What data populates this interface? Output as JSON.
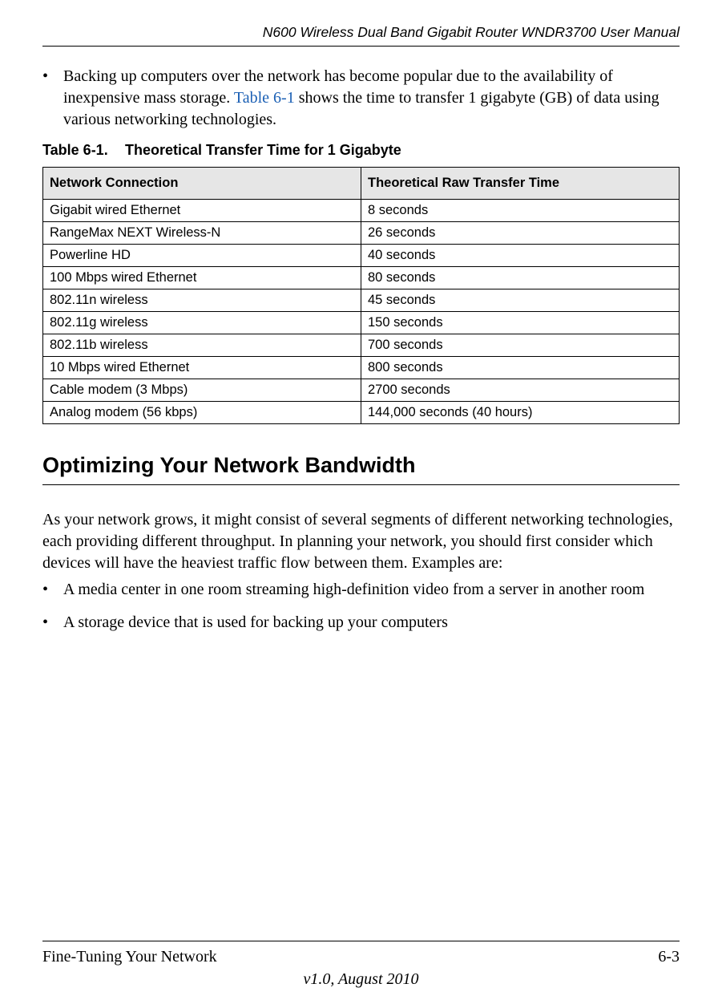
{
  "header": {
    "title": "N600 Wireless Dual Band Gigabit Router WNDR3700 User Manual"
  },
  "intro_bullet": {
    "text_before_link": "Backing up computers over the network has become popular due to the availability of inexpensive mass storage. ",
    "link_text": "Table 6-1",
    "text_after_link": " shows the time to transfer 1 gigabyte (GB) of data using various networking technologies."
  },
  "table": {
    "caption_label": "Table 6-1.",
    "caption_title": "Theoretical Transfer Time for 1 Gigabyte",
    "headers": {
      "col1": "Network Connection",
      "col2": "Theoretical Raw Transfer Time"
    },
    "rows": [
      {
        "connection": "Gigabit wired Ethernet",
        "time": "8 seconds"
      },
      {
        "connection": "RangeMax NEXT Wireless-N",
        "time": "26 seconds"
      },
      {
        "connection": "Powerline HD",
        "time": "40 seconds"
      },
      {
        "connection": "100 Mbps wired Ethernet",
        "time": "80 seconds"
      },
      {
        "connection": "802.11n wireless",
        "time": "45 seconds"
      },
      {
        "connection": "802.11g wireless",
        "time": "150 seconds"
      },
      {
        "connection": "802.11b wireless",
        "time": "700 seconds"
      },
      {
        "connection": "10 Mbps wired Ethernet",
        "time": "800 seconds"
      },
      {
        "connection": "Cable modem (3 Mbps)",
        "time": "2700 seconds"
      },
      {
        "connection": "Analog modem (56 kbps)",
        "time": "144,000 seconds (40 hours)"
      }
    ]
  },
  "section_heading": "Optimizing Your Network Bandwidth",
  "section_paragraph": "As your network grows, it might consist of several segments of different networking technologies, each providing different throughput. In planning your network, you should first consider which devices will have the heaviest traffic flow between them. Examples are:",
  "section_bullets": [
    "A media center in one room streaming high-definition video from a server in another room",
    "A storage device that is used for backing up your computers"
  ],
  "footer": {
    "left": "Fine-Tuning Your Network",
    "right": "6-3",
    "center": "v1.0, August 2010"
  },
  "chart_data": {
    "type": "table",
    "title": "Theoretical Transfer Time for 1 Gigabyte",
    "columns": [
      "Network Connection",
      "Theoretical Raw Transfer Time"
    ],
    "rows": [
      [
        "Gigabit wired Ethernet",
        "8 seconds"
      ],
      [
        "RangeMax NEXT Wireless-N",
        "26 seconds"
      ],
      [
        "Powerline HD",
        "40 seconds"
      ],
      [
        "100 Mbps wired Ethernet",
        "80 seconds"
      ],
      [
        "802.11n wireless",
        "45 seconds"
      ],
      [
        "802.11g wireless",
        "150 seconds"
      ],
      [
        "802.11b wireless",
        "700 seconds"
      ],
      [
        "10 Mbps wired Ethernet",
        "800 seconds"
      ],
      [
        "Cable modem (3 Mbps)",
        "2700 seconds"
      ],
      [
        "Analog modem (56 kbps)",
        "144,000 seconds (40 hours)"
      ]
    ]
  }
}
